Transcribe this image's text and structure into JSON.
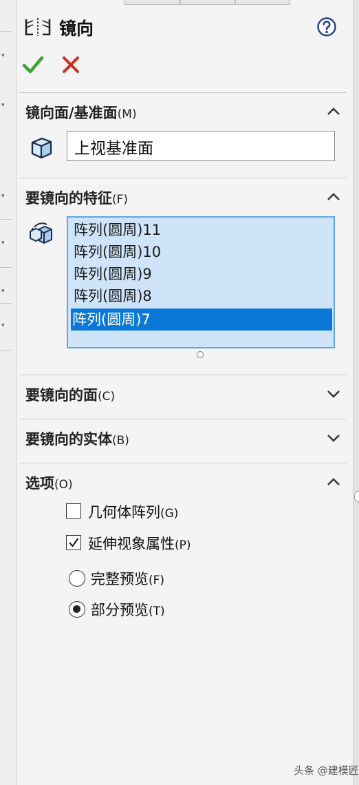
{
  "panel": {
    "title": "镜向",
    "help_icon": "help-icon"
  },
  "actions": {
    "ok_icon": "checkmark-icon",
    "cancel_icon": "close-icon",
    "ok_color": "#3aa335",
    "cancel_color": "#d22a1c"
  },
  "sections": {
    "mirror_plane": {
      "title": "镜向面/基准面",
      "key": "(M)",
      "expanded": true,
      "value": "上视基准面"
    },
    "features": {
      "title": "要镜向的特征",
      "key": "(F)",
      "expanded": true,
      "items": [
        {
          "label": "阵列(圆周)11",
          "selected": false
        },
        {
          "label": "阵列(圆周)10",
          "selected": false
        },
        {
          "label": "阵列(圆周)9",
          "selected": false
        },
        {
          "label": "阵列(圆周)8",
          "selected": false
        },
        {
          "label": "阵列(圆周)7",
          "selected": true
        }
      ]
    },
    "faces": {
      "title": "要镜向的面",
      "key": "(C)",
      "expanded": false
    },
    "bodies": {
      "title": "要镜向的实体",
      "key": "(B)",
      "expanded": false
    },
    "options": {
      "title": "选项",
      "key": "(O)",
      "expanded": true,
      "geometry_pattern": {
        "label": "几何体阵列",
        "key": "(G)",
        "checked": false
      },
      "propagate_visual": {
        "label": "延伸视象属性",
        "key": "(P)",
        "checked": true
      },
      "full_preview": {
        "label": "完整预览",
        "key": "(F)",
        "selected": false
      },
      "partial_preview": {
        "label": "部分预览",
        "key": "(T)",
        "selected": true
      }
    }
  },
  "watermark": "头条 @建模匠",
  "colors": {
    "accent_selection": "#0a78d7",
    "list_background": "#cfe4f9",
    "list_border": "#5ba7e6"
  }
}
